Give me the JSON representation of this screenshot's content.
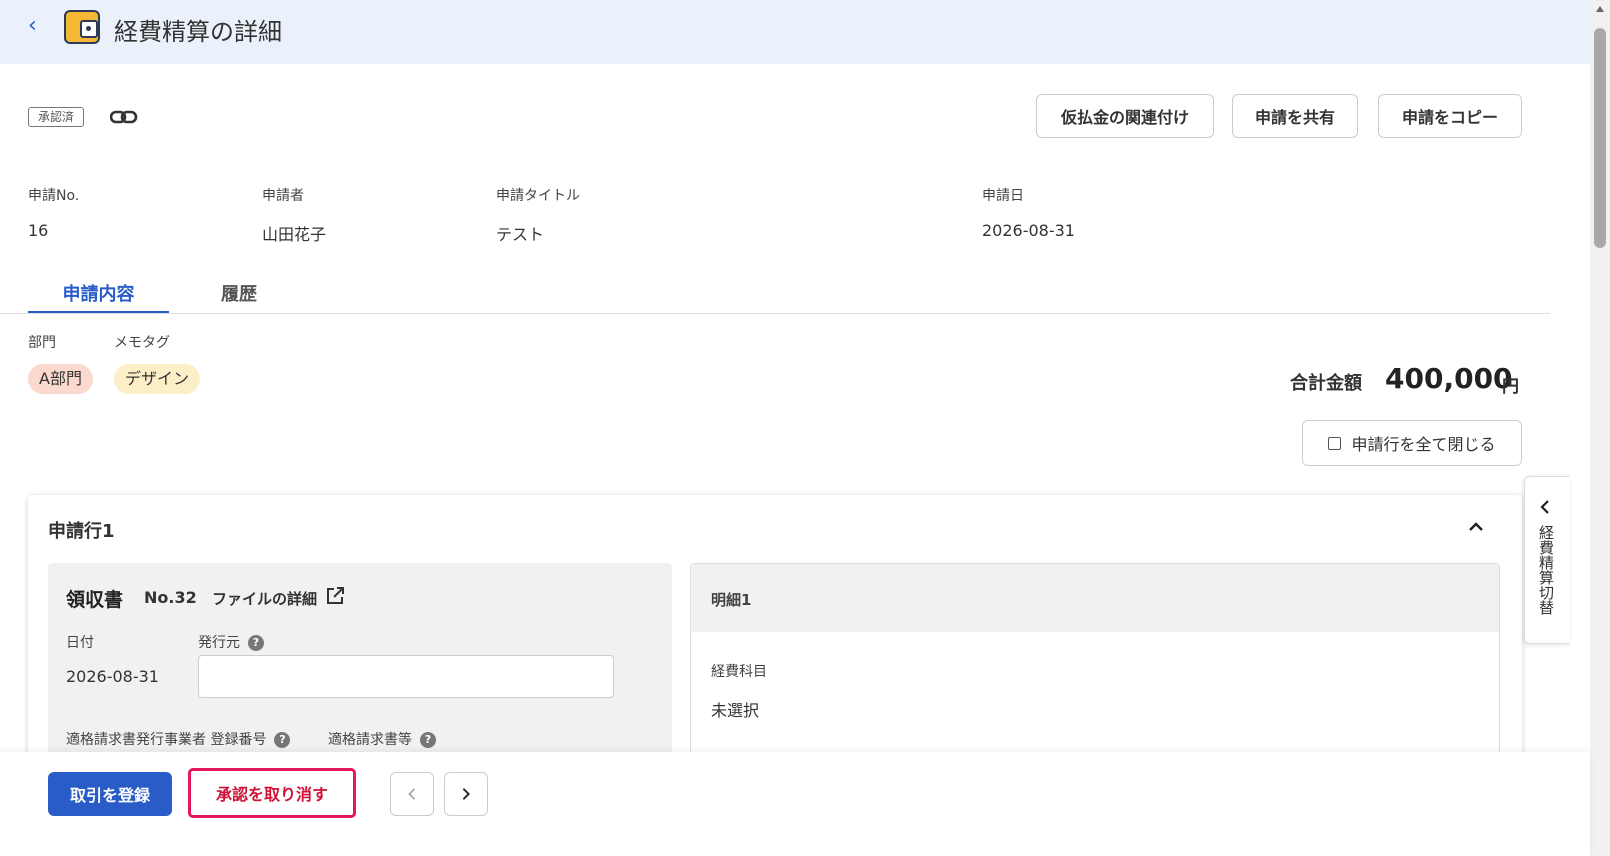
{
  "header": {
    "title": "経費精算の詳細",
    "back_icon": "chevron-left-icon",
    "app_icon": "wallet-icon"
  },
  "status": {
    "badge": "承認済"
  },
  "actions": {
    "link_advance": "仮払金の関連付け",
    "share": "申請を共有",
    "copy": "申請をコピー"
  },
  "info": {
    "labels": {
      "no": "申請No.",
      "applicant": "申請者",
      "title": "申請タイトル",
      "date": "申請日"
    },
    "values": {
      "no": "16",
      "applicant": "山田花子",
      "title": "テスト",
      "date": "2026-08-31"
    }
  },
  "tabs": [
    {
      "label": "申請内容",
      "active": true
    },
    {
      "label": "履歴",
      "active": false
    }
  ],
  "tags": {
    "dept_label": "部門",
    "memo_label": "メモタグ",
    "dept": "A部門",
    "memo": "デザイン"
  },
  "total": {
    "label": "合計金額",
    "amount": "400,000",
    "unit": "円"
  },
  "close_all": {
    "label": "申請行を全て閉じる"
  },
  "line": {
    "title": "申請行1",
    "receipt": {
      "title": "領収書",
      "no": "No.32",
      "file_detail": "ファイルの詳細",
      "date_label": "日付",
      "date_value": "2026-08-31",
      "issuer_label": "発行元",
      "issuer_value": "",
      "reg_no_label": "適格請求書発行事業者 登録番号",
      "qualified_label": "適格請求書等"
    },
    "detail": {
      "title": "明細1",
      "account_label": "経費科目",
      "account_value": "未選択"
    }
  },
  "side_panel": {
    "label": "経費精算切替"
  },
  "footer": {
    "register": "取引を登録",
    "cancel_approval": "承認を取り消す"
  },
  "colors": {
    "primary": "#2a5cc7",
    "header_bg": "#eaf1fb",
    "danger_outline": "#e5165f",
    "dept_tag_bg": "#fbd9cf",
    "memo_tag_bg": "#fcefc8"
  }
}
